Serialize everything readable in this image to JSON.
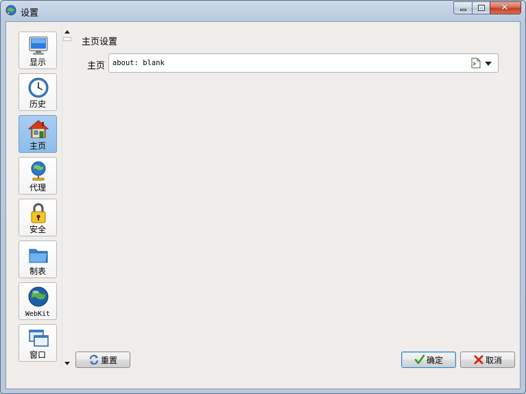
{
  "window": {
    "title": "设置",
    "app_icon": "globe-icon"
  },
  "sidebar": {
    "items": [
      {
        "label": "显示",
        "icon": "monitor-icon",
        "active": false
      },
      {
        "label": "历史",
        "icon": "clock-icon",
        "active": false
      },
      {
        "label": "主页",
        "icon": "house-icon",
        "active": true
      },
      {
        "label": "代理",
        "icon": "network-globe-icon",
        "active": false
      },
      {
        "label": "安全",
        "icon": "padlock-icon",
        "active": false
      },
      {
        "label": "制表",
        "icon": "folder-icon",
        "active": false
      },
      {
        "label": "WebKit",
        "icon": "earth-icon",
        "active": false
      },
      {
        "label": "窗口",
        "icon": "windows-icon",
        "active": false
      }
    ]
  },
  "main": {
    "section_title": "主页设置",
    "home_label": "主页",
    "home_url": "about: blank"
  },
  "buttons": {
    "reset": "重置",
    "ok": "确定",
    "cancel": "取消"
  },
  "colors": {
    "active_item": "#8ebde9",
    "client_bg": "#f0edea",
    "close_button": "#c33a21"
  }
}
